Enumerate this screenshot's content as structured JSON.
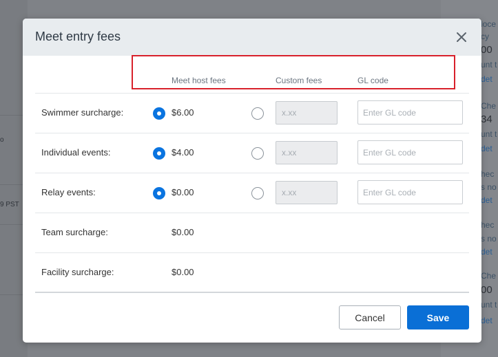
{
  "background": {
    "left_texts": [
      "o",
      "9 PST"
    ],
    "right_texts": [
      {
        "kind": "text",
        "value": "loce"
      },
      {
        "kind": "text",
        "value": "cy"
      },
      {
        "kind": "big",
        "value": "00"
      },
      {
        "kind": "text",
        "value": "unt t"
      },
      {
        "kind": "link",
        "value": "det"
      },
      {
        "kind": "text",
        "value": "Che"
      },
      {
        "kind": "big",
        "value": "34"
      },
      {
        "kind": "text",
        "value": "unt t"
      },
      {
        "kind": "link",
        "value": "det"
      },
      {
        "kind": "text",
        "value": "hec"
      },
      {
        "kind": "text",
        "value": "s no"
      },
      {
        "kind": "link",
        "value": "det"
      },
      {
        "kind": "text",
        "value": "hec"
      },
      {
        "kind": "text",
        "value": "s no"
      },
      {
        "kind": "link",
        "value": "det"
      },
      {
        "kind": "text",
        "value": "Che"
      },
      {
        "kind": "big",
        "value": "00"
      },
      {
        "kind": "text",
        "value": "unt t"
      },
      {
        "kind": "link",
        "value": "det"
      }
    ]
  },
  "modal": {
    "title": "Meet entry fees",
    "close_symbol": "×",
    "columns": {
      "host": "Meet host fees",
      "custom": "Custom fees",
      "gl": "GL code"
    },
    "rows": [
      {
        "label": "Swimmer surcharge:",
        "amount": "$6.00",
        "custom_placeholder": "x.xx",
        "gl_placeholder": "Enter GL code",
        "host_selected": true
      },
      {
        "label": "Individual events:",
        "amount": "$4.00",
        "custom_placeholder": "x.xx",
        "gl_placeholder": "Enter GL code",
        "host_selected": true
      },
      {
        "label": "Relay events:",
        "amount": "$0.00",
        "custom_placeholder": "x.xx",
        "gl_placeholder": "Enter GL code",
        "host_selected": true
      },
      {
        "label": "Team surcharge:",
        "amount": "$0.00"
      },
      {
        "label": "Facility surcharge:",
        "amount": "$0.00"
      }
    ],
    "buttons": {
      "cancel": "Cancel",
      "save": "Save"
    },
    "colors": {
      "accent": "#0a6fd6",
      "highlight": "#d8202a",
      "header_bg": "#e8ecef"
    }
  }
}
